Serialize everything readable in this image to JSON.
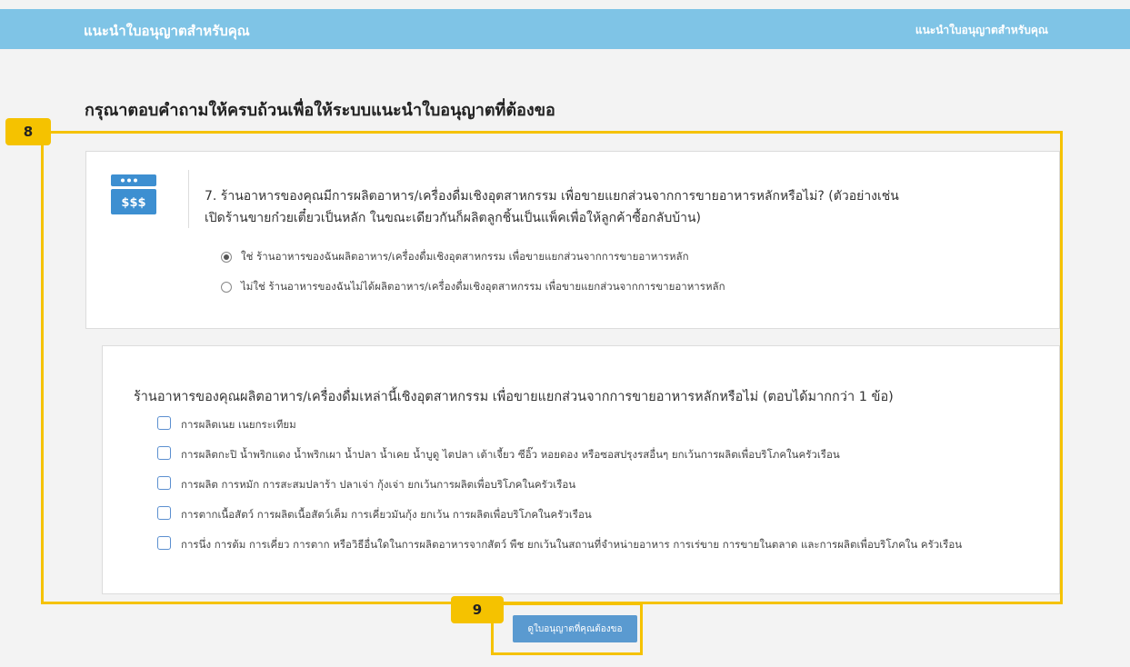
{
  "topbar": {
    "brand": "แนะนำใบอนุญาตสำหรับคุณ",
    "nav_link": "แนะนำใบอนุญาตสำหรับคุณ"
  },
  "heading": "กรุณาตอบคำถามให้ครบถ้วนเพื่อให้ระบบแนะนำใบอนุญาตที่ต้องขอ",
  "question": {
    "icon": "shop-window-icon",
    "icon_text": "$$$",
    "line1": "7. ร้านอาหารของคุณมีการผลิตอาหาร/เครื่องดื่มเชิงอุตสาหกรรม เพื่อขายแยกส่วนจากการขายอาหารหลักหรือไม่? (ตัวอย่างเช่น",
    "line2": "เปิดร้านขายก๋วยเตี๋ยวเป็นหลัก ในขณะเดียวกันก็ผลิตลูกชิ้นเป็นแพ็คเพื่อให้ลูกค้าซื้อกลับบ้าน)",
    "options": [
      {
        "label": "ใช่ ร้านอาหารของฉันผลิตอาหาร/เครื่องดื่มเชิงอุตสาหกรรม เพื่อขายแยกส่วนจากการขายอาหารหลัก",
        "selected": true
      },
      {
        "label": "ไม่ใช่ ร้านอาหารของฉันไม่ได้ผลิตอาหาร/เครื่องดื่มเชิงอุตสาหกรรม เพื่อขายแยกส่วนจากการขายอาหารหลัก",
        "selected": false
      }
    ]
  },
  "sub_question": {
    "text": "ร้านอาหารของคุณผลิตอาหาร/เครื่องดื่มเหล่านี้เชิงอุตสาหกรรม เพื่อขายแยกส่วนจากการขายอาหารหลักหรือไม่ (ตอบได้มากกว่า 1 ข้อ)",
    "items": [
      "การผลิตเนย เนยกระเทียม",
      "การผลิตกะปิ น้ำพริกแดง น้ำพริกเผา น้ำปลา น้ำเคย น้ำบูดู ไตปลา เต้าเจี้ยว ซีอิ๊ว หอยดอง หรือซอสปรุงรสอื่นๆ ยกเว้นการผลิตเพื่อบริโภคในครัวเรือน",
      "การผลิต การหมัก การสะสมปลาร้า ปลาเจ่า กุ้งเจ่า ยกเว้นการผลิตเพื่อบริโภคในครัวเรือน",
      "การตากเนื้อสัตว์ การผลิตเนื้อสัตว์เค็ม การเคี่ยวมันกุ้ง ยกเว้น การผลิตเพื่อบริโภคในครัวเรือน",
      "การนึ่ง การต้ม การเคี่ยว การตาก หรือวิธีอื่นใดในการผลิตอาหารจากสัตว์ พืช ยกเว้นในสถานที่จำหน่ายอาหาร การเร่ขาย การขายในตลาด และการผลิตเพื่อบริโภคใน ครัวเรือน"
    ]
  },
  "annotations": {
    "label_8": "8",
    "label_9": "9",
    "color": "#f5c200"
  },
  "submit_button": "ดูใบอนุญาตที่คุณต้องขอ",
  "colors": {
    "header": "#7fc4e6",
    "button": "#5a9ad0",
    "checkbox_border": "#5b8fd0"
  }
}
